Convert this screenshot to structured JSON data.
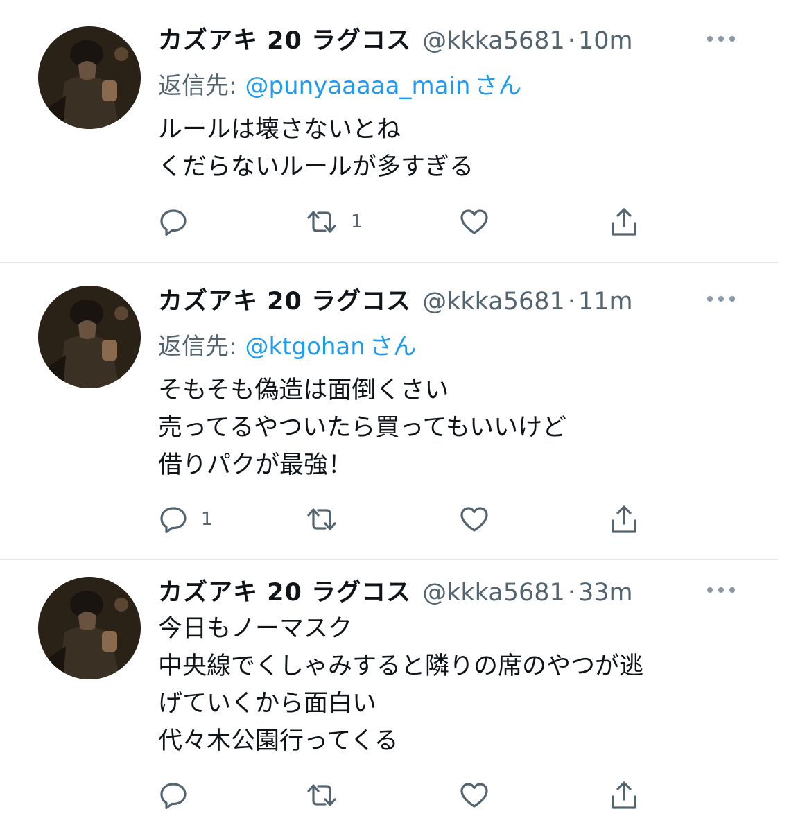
{
  "tweets": [
    {
      "author_name": "カズアキ 20 ラグコス",
      "handle": "@kkka5681",
      "separator": "·",
      "time": "10m",
      "reply_label": "返信先:",
      "reply_user": "@punyaaaaa_main",
      "reply_suffix": "さん",
      "lines": [
        "ルールは壊さないとね",
        "くだらないルールが多すぎる"
      ],
      "reply_count": "",
      "retweet_count": "1",
      "like_count": ""
    },
    {
      "author_name": "カズアキ 20 ラグコス",
      "handle": "@kkka5681",
      "separator": "·",
      "time": "11m",
      "reply_label": "返信先:",
      "reply_user": "@ktgohan",
      "reply_suffix": "さん",
      "lines": [
        "そもそも偽造は面倒くさい",
        "売ってるやついたら買ってもいいけど",
        "借りパクが最強！"
      ],
      "reply_count": "1",
      "retweet_count": "",
      "like_count": ""
    },
    {
      "author_name": "カズアキ 20 ラグコス",
      "handle": "@kkka5681",
      "separator": "·",
      "time": "33m",
      "lines": [
        "今日もノーマスク",
        "中央線でくしゃみすると隣りの席のやつが逃",
        "げていくから面白い",
        "代々木公園行ってくる"
      ],
      "reply_count": "",
      "retweet_count": "",
      "like_count": ""
    }
  ],
  "colors": {
    "text": "#0f1419",
    "secondary": "#536471",
    "link": "#1d9bf0",
    "divider": "#e3e6e8"
  },
  "icons": [
    "reply-icon",
    "retweet-icon",
    "like-icon",
    "share-icon",
    "more-icon"
  ]
}
